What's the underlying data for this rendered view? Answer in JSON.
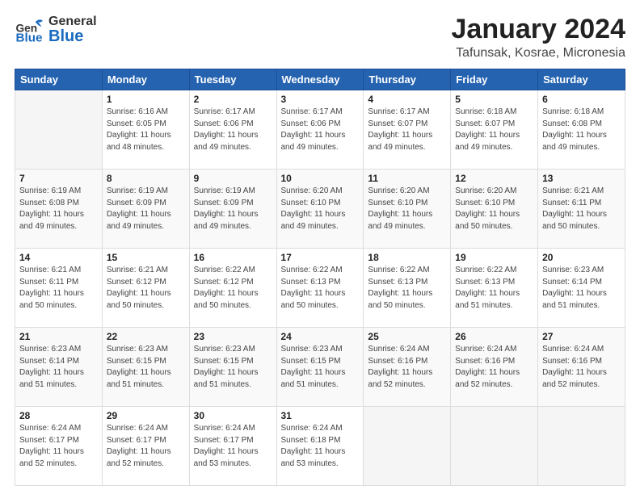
{
  "header": {
    "logo": {
      "general": "General",
      "blue": "Blue"
    },
    "title": "January 2024",
    "location": "Tafunsak, Kosrae, Micronesia"
  },
  "days_of_week": [
    "Sunday",
    "Monday",
    "Tuesday",
    "Wednesday",
    "Thursday",
    "Friday",
    "Saturday"
  ],
  "weeks": [
    [
      {
        "day": "",
        "info": ""
      },
      {
        "day": "1",
        "info": "Sunrise: 6:16 AM\nSunset: 6:05 PM\nDaylight: 11 hours\nand 48 minutes."
      },
      {
        "day": "2",
        "info": "Sunrise: 6:17 AM\nSunset: 6:06 PM\nDaylight: 11 hours\nand 49 minutes."
      },
      {
        "day": "3",
        "info": "Sunrise: 6:17 AM\nSunset: 6:06 PM\nDaylight: 11 hours\nand 49 minutes."
      },
      {
        "day": "4",
        "info": "Sunrise: 6:17 AM\nSunset: 6:07 PM\nDaylight: 11 hours\nand 49 minutes."
      },
      {
        "day": "5",
        "info": "Sunrise: 6:18 AM\nSunset: 6:07 PM\nDaylight: 11 hours\nand 49 minutes."
      },
      {
        "day": "6",
        "info": "Sunrise: 6:18 AM\nSunset: 6:08 PM\nDaylight: 11 hours\nand 49 minutes."
      }
    ],
    [
      {
        "day": "7",
        "info": "Sunrise: 6:19 AM\nSunset: 6:08 PM\nDaylight: 11 hours\nand 49 minutes."
      },
      {
        "day": "8",
        "info": "Sunrise: 6:19 AM\nSunset: 6:09 PM\nDaylight: 11 hours\nand 49 minutes."
      },
      {
        "day": "9",
        "info": "Sunrise: 6:19 AM\nSunset: 6:09 PM\nDaylight: 11 hours\nand 49 minutes."
      },
      {
        "day": "10",
        "info": "Sunrise: 6:20 AM\nSunset: 6:10 PM\nDaylight: 11 hours\nand 49 minutes."
      },
      {
        "day": "11",
        "info": "Sunrise: 6:20 AM\nSunset: 6:10 PM\nDaylight: 11 hours\nand 49 minutes."
      },
      {
        "day": "12",
        "info": "Sunrise: 6:20 AM\nSunset: 6:10 PM\nDaylight: 11 hours\nand 50 minutes."
      },
      {
        "day": "13",
        "info": "Sunrise: 6:21 AM\nSunset: 6:11 PM\nDaylight: 11 hours\nand 50 minutes."
      }
    ],
    [
      {
        "day": "14",
        "info": "Sunrise: 6:21 AM\nSunset: 6:11 PM\nDaylight: 11 hours\nand 50 minutes."
      },
      {
        "day": "15",
        "info": "Sunrise: 6:21 AM\nSunset: 6:12 PM\nDaylight: 11 hours\nand 50 minutes."
      },
      {
        "day": "16",
        "info": "Sunrise: 6:22 AM\nSunset: 6:12 PM\nDaylight: 11 hours\nand 50 minutes."
      },
      {
        "day": "17",
        "info": "Sunrise: 6:22 AM\nSunset: 6:13 PM\nDaylight: 11 hours\nand 50 minutes."
      },
      {
        "day": "18",
        "info": "Sunrise: 6:22 AM\nSunset: 6:13 PM\nDaylight: 11 hours\nand 50 minutes."
      },
      {
        "day": "19",
        "info": "Sunrise: 6:22 AM\nSunset: 6:13 PM\nDaylight: 11 hours\nand 51 minutes."
      },
      {
        "day": "20",
        "info": "Sunrise: 6:23 AM\nSunset: 6:14 PM\nDaylight: 11 hours\nand 51 minutes."
      }
    ],
    [
      {
        "day": "21",
        "info": "Sunrise: 6:23 AM\nSunset: 6:14 PM\nDaylight: 11 hours\nand 51 minutes."
      },
      {
        "day": "22",
        "info": "Sunrise: 6:23 AM\nSunset: 6:15 PM\nDaylight: 11 hours\nand 51 minutes."
      },
      {
        "day": "23",
        "info": "Sunrise: 6:23 AM\nSunset: 6:15 PM\nDaylight: 11 hours\nand 51 minutes."
      },
      {
        "day": "24",
        "info": "Sunrise: 6:23 AM\nSunset: 6:15 PM\nDaylight: 11 hours\nand 51 minutes."
      },
      {
        "day": "25",
        "info": "Sunrise: 6:24 AM\nSunset: 6:16 PM\nDaylight: 11 hours\nand 52 minutes."
      },
      {
        "day": "26",
        "info": "Sunrise: 6:24 AM\nSunset: 6:16 PM\nDaylight: 11 hours\nand 52 minutes."
      },
      {
        "day": "27",
        "info": "Sunrise: 6:24 AM\nSunset: 6:16 PM\nDaylight: 11 hours\nand 52 minutes."
      }
    ],
    [
      {
        "day": "28",
        "info": "Sunrise: 6:24 AM\nSunset: 6:17 PM\nDaylight: 11 hours\nand 52 minutes."
      },
      {
        "day": "29",
        "info": "Sunrise: 6:24 AM\nSunset: 6:17 PM\nDaylight: 11 hours\nand 52 minutes."
      },
      {
        "day": "30",
        "info": "Sunrise: 6:24 AM\nSunset: 6:17 PM\nDaylight: 11 hours\nand 53 minutes."
      },
      {
        "day": "31",
        "info": "Sunrise: 6:24 AM\nSunset: 6:18 PM\nDaylight: 11 hours\nand 53 minutes."
      },
      {
        "day": "",
        "info": ""
      },
      {
        "day": "",
        "info": ""
      },
      {
        "day": "",
        "info": ""
      }
    ]
  ]
}
